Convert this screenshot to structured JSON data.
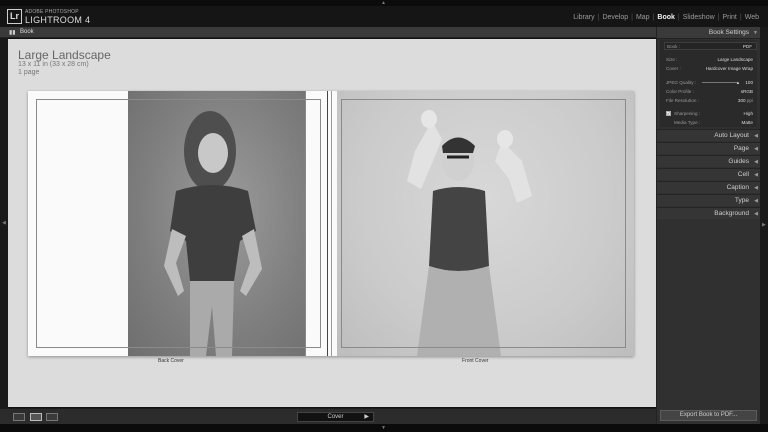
{
  "identity": {
    "logo": "Lr",
    "brand_small": "ADOBE PHOTOSHOP",
    "brand_big": "LIGHTROOM 4",
    "modules": [
      "Library",
      "Develop",
      "Map",
      "Book",
      "Slideshow",
      "Print",
      "Web"
    ],
    "active_module": "Book"
  },
  "left_header": {
    "label": "Book",
    "icon": "book-icon"
  },
  "page_info": {
    "title": "Large Landscape",
    "size": "13 x 11 in (33 x 28 cm)",
    "count": "1 page"
  },
  "spread": {
    "back_caption": "Back Cover",
    "front_caption": "Front Cover"
  },
  "bottom_bar": {
    "view_icons": [
      "multi-page-view-icon",
      "spread-view-icon",
      "single-page-view-icon"
    ],
    "cover_select": "Cover"
  },
  "right_panel": {
    "book_settings_title": "Book Settings",
    "book_label": "Book :",
    "book_value": "PDF",
    "size_label": "Size :",
    "size_value": "Large Landscape",
    "cover_label": "Cover :",
    "cover_value": "Hardcover Image Wrap",
    "jpeg_label": "JPEG Quality :",
    "jpeg_value": "100",
    "profile_label": "Color Profile :",
    "profile_value": "sRGB",
    "resolution_label": "File Resolution :",
    "resolution_value": "300",
    "resolution_unit": "ppi",
    "sharpening_label": "Sharpening :",
    "sharpening_value": "High",
    "media_label": "Media Type :",
    "media_value": "Matte",
    "sections": [
      "Auto Layout",
      "Page",
      "Guides",
      "Cell",
      "Caption",
      "Type",
      "Background"
    ],
    "export_button": "Export Book to PDF..."
  },
  "colors": {
    "accent": "#f2f2f2",
    "panel": "#303030",
    "canvas": "#dcdcdc"
  }
}
